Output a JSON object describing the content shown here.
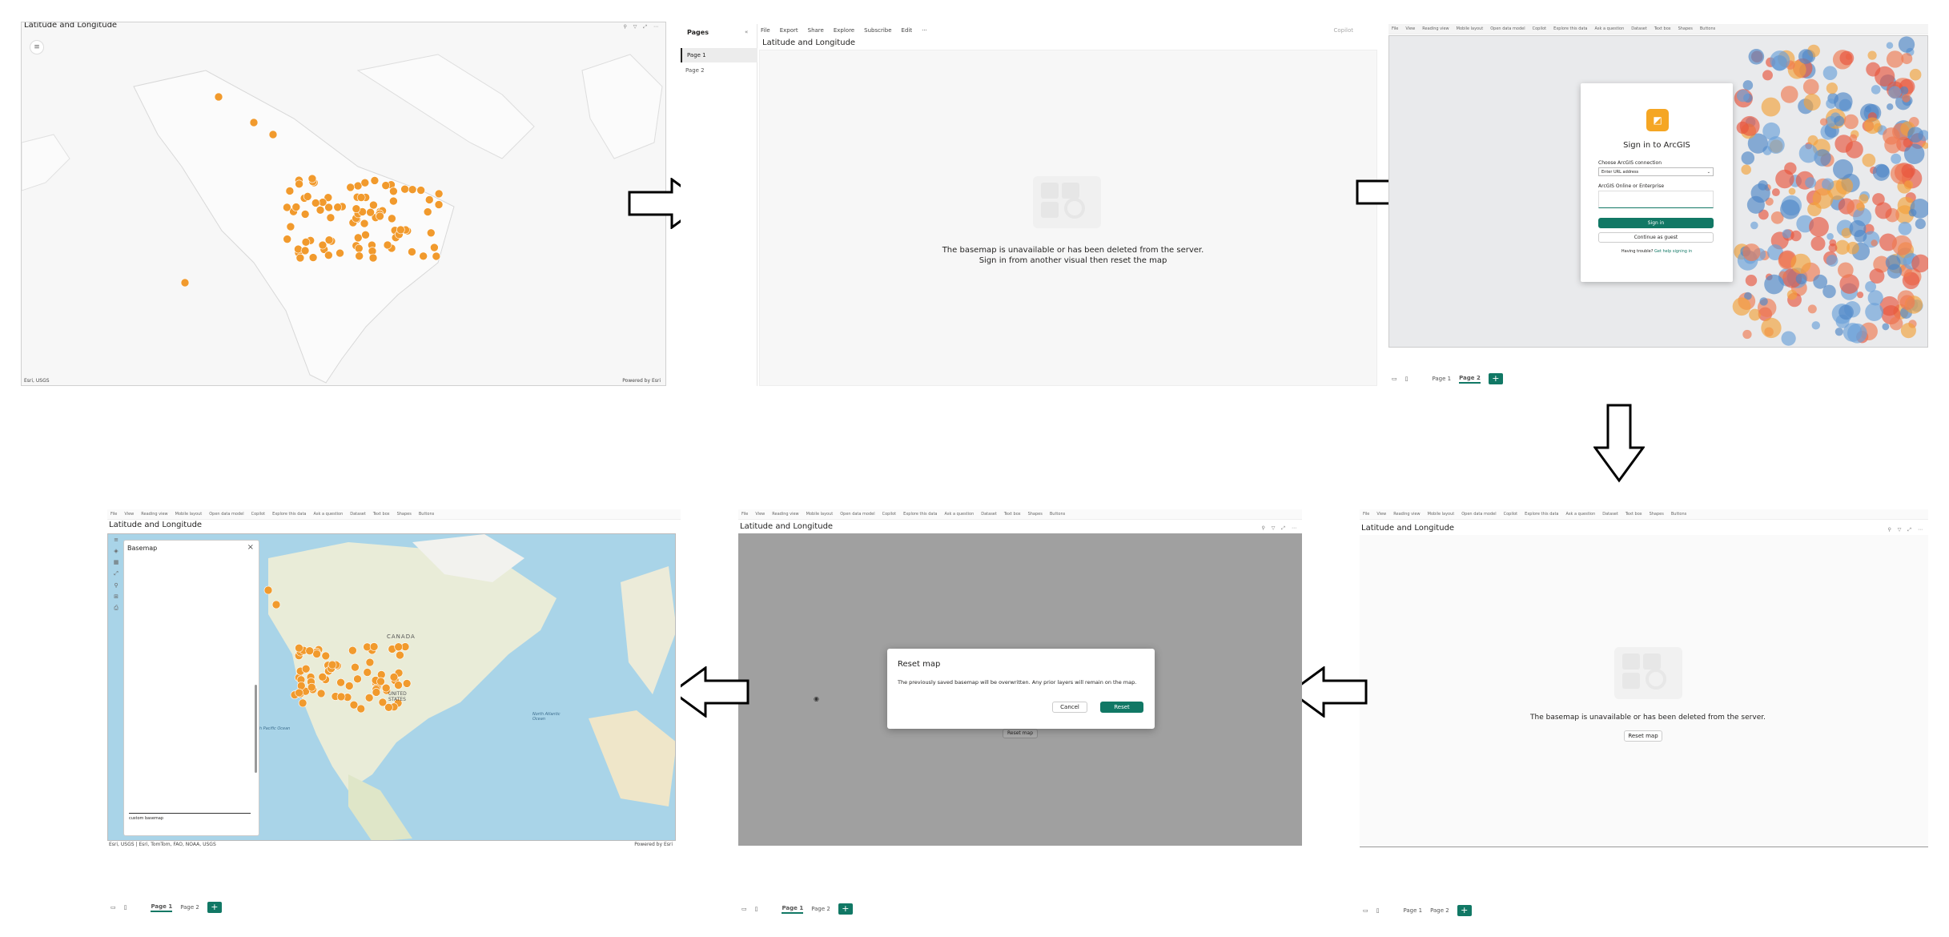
{
  "panel1": {
    "title": "Latitude and Longitude",
    "attribution": "Esri, USGS",
    "powered": "Powered by Esri"
  },
  "panel2": {
    "pages_header": "Pages",
    "pages": [
      "Page 1",
      "Page 2"
    ],
    "toolbar": [
      "File",
      "Export",
      "Share",
      "Explore",
      "Subscribe",
      "Edit",
      "···"
    ],
    "copilot": "Copilot",
    "title": "Latitude and Longitude",
    "message_line1": "The basemap is unavailable or has been deleted from the server.",
    "message_line2": "Sign in from another visual then reset the map"
  },
  "panel3": {
    "toolbar": [
      "File",
      "View",
      "Reading view",
      "Mobile layout",
      "Open data model",
      "Copilot",
      "Explore this data",
      "Ask a question",
      "Dataset",
      "Text box",
      "Shapes",
      "Buttons"
    ],
    "dialog_title": "Sign in to ArcGIS",
    "connection_label": "Choose ArcGIS connection",
    "connection_value": "Enter URL address",
    "online_label": "ArcGIS Online or Enterprise",
    "signin_button": "Sign in",
    "guest_button": "Continue as guest",
    "help_text": "Having trouble?",
    "help_link": "Get help signing in",
    "pages": [
      "Page 1",
      "Page 2"
    ],
    "add_page": "+"
  },
  "panel4": {
    "toolbar": [
      "File",
      "View",
      "Reading view",
      "Mobile layout",
      "Open data model",
      "Copilot",
      "Explore this data",
      "Ask a question",
      "Dataset",
      "Text box",
      "Shapes",
      "Buttons"
    ],
    "title": "Latitude and Longitude",
    "message": "The basemap is unavailable or has been deleted from the server.",
    "reset_button": "Reset map",
    "pages": [
      "Page 1",
      "Page 2"
    ],
    "add_page": "+"
  },
  "panel5": {
    "toolbar": [
      "File",
      "View",
      "Reading view",
      "Mobile layout",
      "Open data model",
      "Copilot",
      "Explore this data",
      "Ask a question",
      "Dataset",
      "Text box",
      "Shapes",
      "Buttons"
    ],
    "title": "Latitude and Longitude",
    "dialog_title": "Reset map",
    "dialog_text": "The previously saved basemap will be overwritten. Any prior layers will remain on the map.",
    "cancel": "Cancel",
    "reset": "Reset",
    "behind_button": "Reset map",
    "pages": [
      "Page 1",
      "Page 2"
    ],
    "add_page": "+"
  },
  "panel6": {
    "toolbar": [
      "File",
      "View",
      "Reading view",
      "Mobile layout",
      "Open data model",
      "Copilot",
      "Explore this data",
      "Ask a question",
      "Dataset",
      "Text box",
      "Shapes",
      "Buttons"
    ],
    "title": "Latitude and Longitude",
    "basemap_panel_title": "Basemap",
    "basemap_footer": "custom basemap",
    "labels": [
      "CANADA",
      "UNITED STATES",
      "North Pacific Ocean",
      "North Atlantic Ocean"
    ],
    "attribution": "Esri, USGS | Esri, TomTom, FAO, NOAA, USGS",
    "powered": "Powered by Esri",
    "pages": [
      "Page 1",
      "Page 2"
    ],
    "add_page": "+"
  },
  "colors": {
    "accent": "#117865",
    "points": "#f19a2d",
    "arcgis_logo": "#f5a623"
  }
}
